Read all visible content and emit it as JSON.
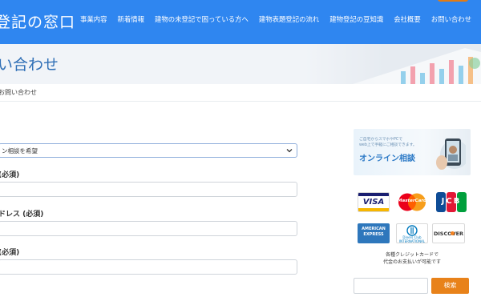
{
  "header": {
    "site_title": "登記の窓口",
    "nav": [
      "事業内容",
      "新着情報",
      "建物の未登記で困っている方へ",
      "建物表題登記の流れ",
      "建物登記の豆知識",
      "会社概要",
      "お問い合わせ"
    ]
  },
  "page": {
    "title": "い合わせ",
    "breadcrumb": "お問い合わせ"
  },
  "form": {
    "select_value": "ン相談を希望",
    "fields": [
      {
        "label": "(必須)"
      },
      {
        "label": "ドレス (必須)"
      },
      {
        "label": "(必須)"
      }
    ]
  },
  "sidebar": {
    "banner": {
      "sub_line1": "ご自宅からスマホやPCで",
      "sub_line2": "web上で手軽にご相談できます。",
      "main": "オンライン相談"
    },
    "cards": [
      "VISA",
      "MasterCard",
      "JCB",
      "AMERICAN EXPRESS",
      "Diners Club INTERNATIONAL",
      "DISCOVER"
    ],
    "card_caption_line1": "各種クレジットカードで",
    "card_caption_line2": "代金のお支払いが可能です",
    "search_button": "検索"
  },
  "colors": {
    "header_blue": "#2f86f0",
    "title_blue": "#2f6fb6",
    "accent_orange": "#e8821a"
  }
}
